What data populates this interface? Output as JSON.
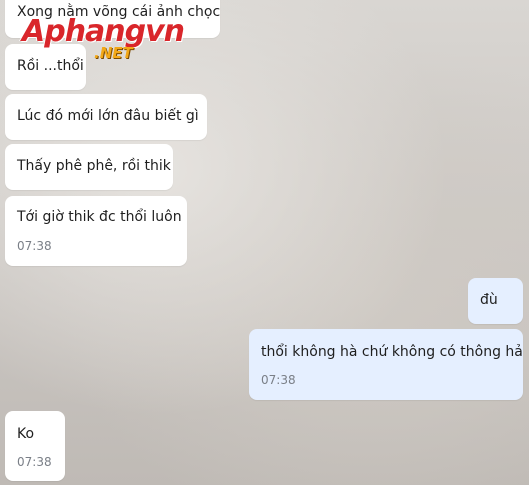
{
  "watermark": {
    "main": "Aphangvn",
    "sub": ".NET"
  },
  "messages": [
    {
      "side": "incoming",
      "text": "Xong nằm võng cái ảnh chọc",
      "time": ""
    },
    {
      "side": "incoming",
      "text": "Rồi ...thổi",
      "time": ""
    },
    {
      "side": "incoming",
      "text": "Lúc đó mới lớn đâu biết gì",
      "time": ""
    },
    {
      "side": "incoming",
      "text": "Thấy phê phê, rồi thik",
      "time": ""
    },
    {
      "side": "incoming",
      "text": "Tới giờ thik đc thổi luôn",
      "time": "07:38"
    },
    {
      "side": "outgoing",
      "text": "đù",
      "time": ""
    },
    {
      "side": "outgoing",
      "text": "thổi không hà chứ không có thông hả",
      "time": "07:38"
    },
    {
      "side": "incoming",
      "text": "Ko",
      "time": "07:38"
    }
  ]
}
